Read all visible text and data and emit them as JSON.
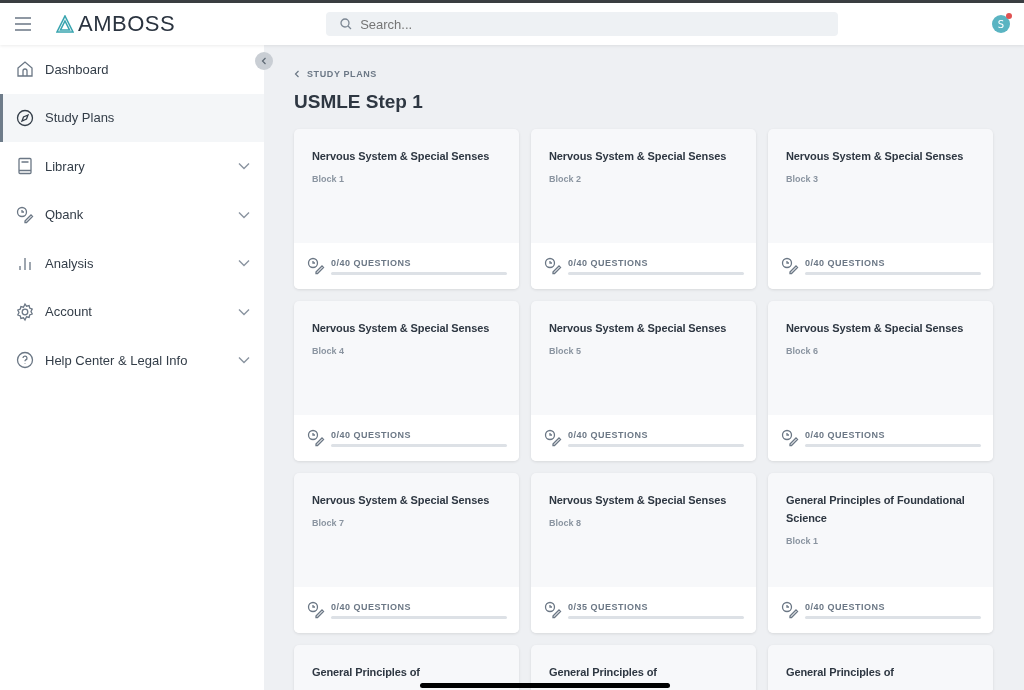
{
  "header": {
    "logo": "AMBOSS",
    "search": {
      "placeholder": "Search..."
    },
    "avatar": {
      "initial": "S",
      "notification": true
    }
  },
  "sidebar": {
    "items": [
      {
        "label": "Dashboard",
        "selected": false
      },
      {
        "label": "Study Plans",
        "selected": true
      },
      {
        "label": "Library",
        "selected": false,
        "expanded": false
      },
      {
        "label": "Qbank",
        "selected": false,
        "expanded": false
      },
      {
        "label": "Analysis",
        "selected": false,
        "expanded": false
      },
      {
        "label": "Account",
        "selected": false,
        "expanded": false
      },
      {
        "label": "Help Center & Legal Info",
        "selected": false,
        "expanded": false
      }
    ]
  },
  "breadcrumb": "STUDY PLANS",
  "title": "USMLE Step 1",
  "cards": [
    {
      "title": "Nervous System & Special Senses",
      "block": "Block 1",
      "progress": "0/40 QUESTIONS",
      "level": 0
    },
    {
      "title": "Nervous System & Special Senses",
      "block": "Block 2",
      "progress": "0/40 QUESTIONS",
      "level": 0
    },
    {
      "title": "Nervous System & Special Senses",
      "block": "Block 3",
      "progress": "0/40 QUESTIONS",
      "level": 0
    },
    {
      "title": "Nervous System & Special Senses",
      "block": "Block 4",
      "progress": "0/40 QUESTIONS",
      "level": 0
    },
    {
      "title": "Nervous System & Special Senses",
      "block": "Block 5",
      "progress": "0/40 QUESTIONS",
      "level": 0
    },
    {
      "title": "Nervous System & Special Senses",
      "block": "Block 6",
      "progress": "0/40 QUESTIONS",
      "level": 0
    },
    {
      "title": "Nervous System & Special Senses",
      "block": "Block 7",
      "progress": "0/40 QUESTIONS",
      "level": 0
    },
    {
      "title": "Nervous System & Special Senses",
      "block": "Block 8",
      "progress": "0/35 QUESTIONS",
      "level": 0
    },
    {
      "title": "General Principles of Foundational Science",
      "block": "Block 1",
      "progress": "0/40 QUESTIONS",
      "level": 0
    },
    {
      "title": "General Principles of"
    },
    {
      "title": "General Principles of"
    },
    {
      "title": "General Principles of"
    }
  ]
}
